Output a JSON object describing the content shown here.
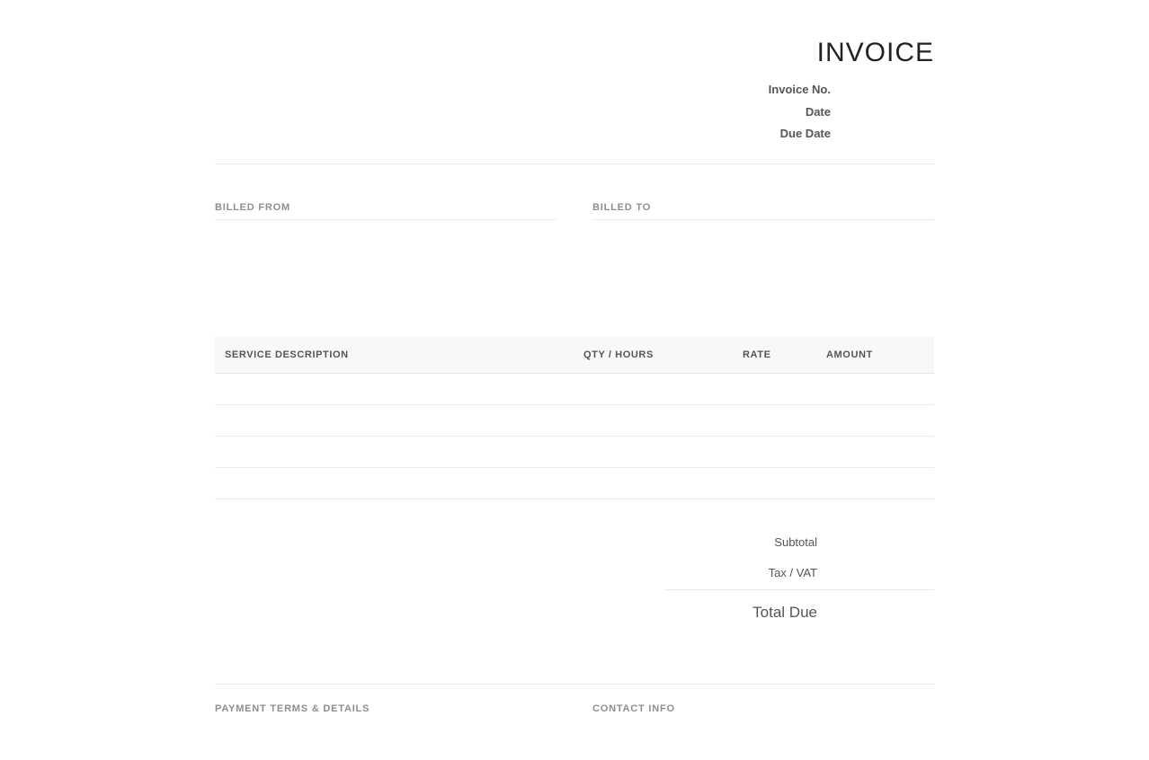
{
  "header": {
    "title": "INVOICE",
    "meta": {
      "invoice_no_label": "Invoice No.",
      "date_label": "Date",
      "due_date_label": "Due Date"
    }
  },
  "parties": {
    "from_label": "BILLED FROM",
    "to_label": "BILLED TO"
  },
  "items": {
    "columns": [
      "SERVICE DESCRIPTION",
      "QTY / HOURS",
      "RATE",
      "AMOUNT"
    ],
    "rows": [
      {
        "description": "",
        "qty": "",
        "rate": "",
        "amount": ""
      },
      {
        "description": "",
        "qty": "",
        "rate": "",
        "amount": ""
      },
      {
        "description": "",
        "qty": "",
        "rate": "",
        "amount": ""
      },
      {
        "description": "",
        "qty": "",
        "rate": "",
        "amount": ""
      }
    ]
  },
  "totals": {
    "subtotal_label": "Subtotal",
    "tax_label": "Tax / VAT",
    "total_due_label": "Total Due"
  },
  "footer": {
    "terms_label": "PAYMENT TERMS & DETAILS",
    "contact_label": "CONTACT INFO"
  },
  "colors": {
    "title": "#222222",
    "text": "#555555",
    "muted_label": "#8e8e8e",
    "table_header_bg": "#f8f8f8",
    "rule": "#e8e8e8"
  }
}
